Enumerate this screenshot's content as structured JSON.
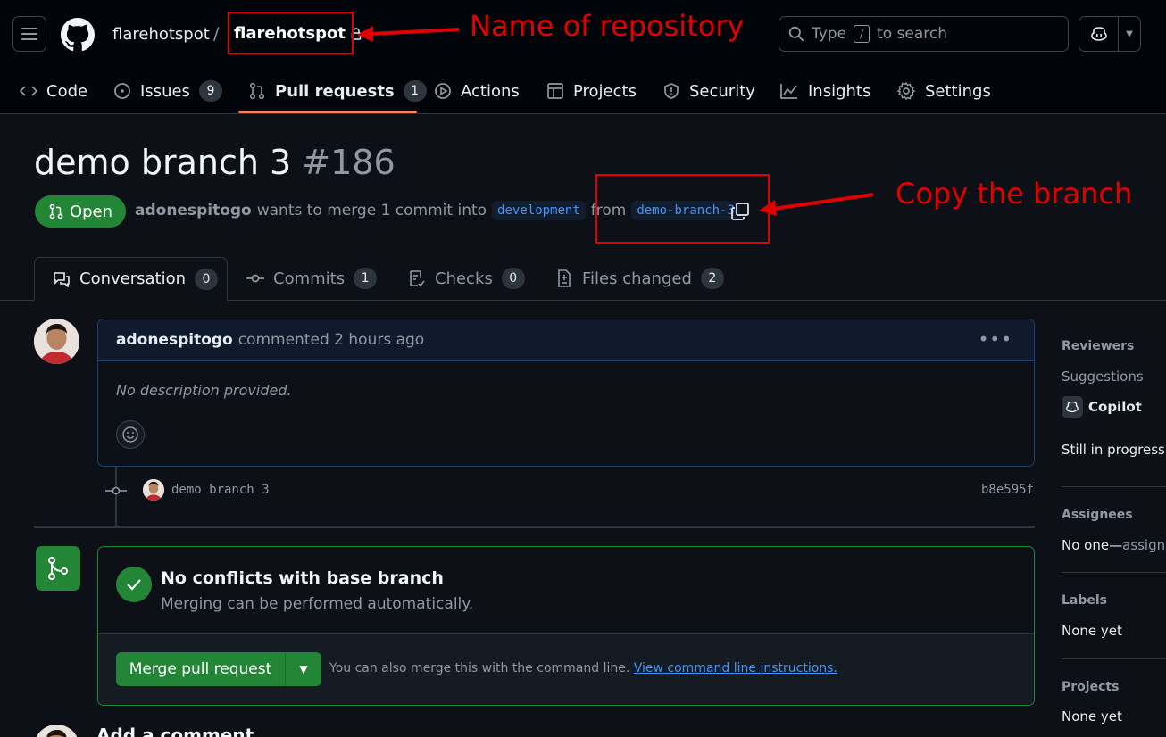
{
  "header": {
    "owner": "flarehotspot",
    "separator": "/",
    "repo": "flarehotspot",
    "search_prefix": "Type",
    "search_key": "/",
    "search_suffix": "to search"
  },
  "nav": {
    "code": "Code",
    "issues": "Issues",
    "issues_count": "9",
    "pulls": "Pull requests",
    "pulls_count": "1",
    "actions": "Actions",
    "projects": "Projects",
    "security": "Security",
    "insights": "Insights",
    "settings": "Settings"
  },
  "pr": {
    "title": "demo branch 3",
    "number": "#186",
    "state": "Open",
    "author": "adonespitogo",
    "merge_text": "wants to merge 1 commit into",
    "base_branch": "development",
    "from_text": "from",
    "head_branch": "demo-branch-3"
  },
  "annotations": {
    "repo_label": "Name of repository",
    "branch_label": "Copy the branch",
    "color": "#e00000"
  },
  "tabs": {
    "conversation": "Conversation",
    "conversation_count": "0",
    "commits": "Commits",
    "commits_count": "1",
    "checks": "Checks",
    "checks_count": "0",
    "files": "Files changed",
    "files_count": "2"
  },
  "comment": {
    "author": "adonespitogo",
    "meta": "commented 2 hours ago",
    "body": "No description provided."
  },
  "commit": {
    "message": "demo branch 3",
    "sha": "b8e595f"
  },
  "merge": {
    "title": "No conflicts with base branch",
    "subtitle": "Merging can be performed automatically.",
    "button": "Merge pull request",
    "hint": "You can also merge this with the command line.",
    "hint_link": "View command line instructions."
  },
  "add_comment": "Add a comment",
  "sidebar": {
    "reviewers": "Reviewers",
    "suggestions": "Suggestions",
    "copilot": "Copilot",
    "still_in_progress": "Still in progress?",
    "assignees": "Assignees",
    "assignees_value": "No one—",
    "assign_link": "assign y",
    "labels": "Labels",
    "labels_value": "None yet",
    "projects": "Projects",
    "projects_value": "None yet"
  },
  "colors": {
    "background": "#0d1117",
    "accent_green": "#238636",
    "link_blue": "#4493f8",
    "nav_underline": "#f78166"
  }
}
